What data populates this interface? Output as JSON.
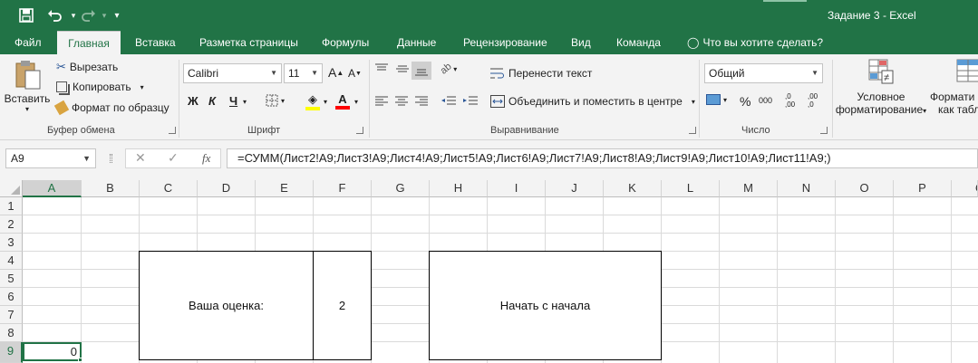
{
  "window": {
    "title": "Задание 3 - Excel"
  },
  "quick_access": {
    "save": "save-icon",
    "undo": "undo-icon",
    "redo": "redo-icon",
    "customize": "▾"
  },
  "tabs": [
    "Файл",
    "Главная",
    "Вставка",
    "Разметка страницы",
    "Формулы",
    "Данные",
    "Рецензирование",
    "Вид",
    "Команда"
  ],
  "active_tab": "Главная",
  "tell_me": "Что вы хотите сделать?",
  "ribbon": {
    "clipboard": {
      "paste": "Вставить",
      "cut": "Вырезать",
      "copy": "Копировать",
      "format_painter": "Формат по образцу",
      "label": "Буфер обмена"
    },
    "font": {
      "name": "Calibri",
      "size": "11",
      "bold": "Ж",
      "italic": "К",
      "underline": "Ч",
      "label": "Шрифт",
      "fill_color": "#ffff00",
      "font_color": "#ff0000"
    },
    "alignment": {
      "wrap": "Перенести текст",
      "merge": "Объединить и поместить в центре",
      "label": "Выравнивание"
    },
    "number": {
      "format": "Общий",
      "percent": "%",
      "thousands": "000",
      "inc_decimal": ",0 ,00",
      "dec_decimal": ",00 ,0",
      "label": "Число"
    },
    "styles": {
      "conditional_line1": "Условное",
      "conditional_line2": "форматирование",
      "table_line1": "Формати",
      "table_line2": "как табл"
    }
  },
  "formula_bar": {
    "name_box": "A9",
    "cancel": "✕",
    "enter": "✓",
    "fx": "fx",
    "formula": "=СУММ(Лист2!A9;Лист3!A9;Лист4!A9;Лист5!A9;Лист6!A9;Лист7!A9;Лист8!A9;Лист9!A9;Лист10!A9;Лист11!A9;)"
  },
  "sheet": {
    "columns": [
      "A",
      "B",
      "C",
      "D",
      "E",
      "F",
      "G",
      "H",
      "I",
      "J",
      "K",
      "L",
      "M",
      "N",
      "O",
      "P",
      "Q"
    ],
    "rows": [
      "1",
      "2",
      "3",
      "4",
      "5",
      "6",
      "7",
      "8",
      "9"
    ],
    "selected_column": "A",
    "selected_row": "9",
    "cell_A9": "0",
    "score_label": "Ваша оценка:",
    "score_value": "2",
    "restart_button": "Начать с начала"
  },
  "colors": {
    "brand": "#217346"
  }
}
